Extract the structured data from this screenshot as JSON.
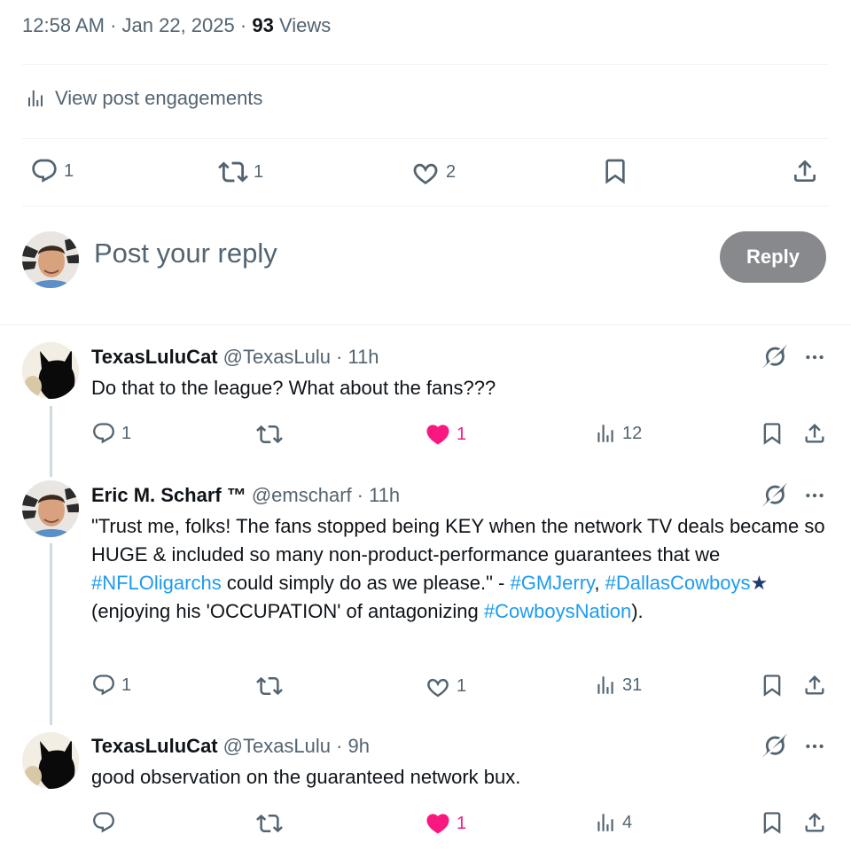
{
  "post": {
    "time": "12:58 AM",
    "date": "Jan 22, 2025",
    "views_count": "93",
    "views_label": "Views",
    "engagements_label": "View post engagements",
    "replies": "1",
    "reposts": "1",
    "likes": "2"
  },
  "composer": {
    "placeholder": "Post your reply",
    "button": "Reply"
  },
  "replies": [
    {
      "name": "TexasLuluCat",
      "handle": "@TexasLulu",
      "time": "· 11h",
      "text": "Do that to the league?  What about the fans???",
      "replies": "1",
      "reposts": "",
      "likes": "1",
      "liked": true,
      "views": "12"
    },
    {
      "name": "Eric M. Scharf ™",
      "handle": "@emscharf",
      "time": "· 11h",
      "text_parts": {
        "p1": "\"Trust me, folks! The fans stopped being KEY when the network TV deals became so HUGE & included so many non-product-performance guarantees that we ",
        "tag1": "#NFLOligarchs",
        "p2": " could simply do as we please.\" - ",
        "tag2": "#GMJerry",
        "p3": ", ",
        "tag3": "#DallasCowboys",
        "star": "★",
        "p4": " (enjoying his 'OCCUPATION' of antagonizing ",
        "tag4": "#CowboysNation",
        "p5": ")."
      },
      "replies": "1",
      "reposts": "",
      "likes": "1",
      "liked": false,
      "views": "31"
    },
    {
      "name": "TexasLuluCat",
      "handle": "@TexasLulu",
      "time": "· 9h",
      "text": "good observation on the guaranteed network bux.",
      "replies": "",
      "reposts": "",
      "likes": "1",
      "liked": true,
      "views": "4"
    }
  ],
  "colors": {
    "accent": "#1d9bf0",
    "like": "#f91880",
    "muted": "#536471",
    "button_disabled": "#87898c"
  },
  "icons": [
    "analytics-icon",
    "reply-icon",
    "repost-icon",
    "like-icon",
    "bookmark-icon",
    "share-icon",
    "grok-icon",
    "more-icon"
  ]
}
